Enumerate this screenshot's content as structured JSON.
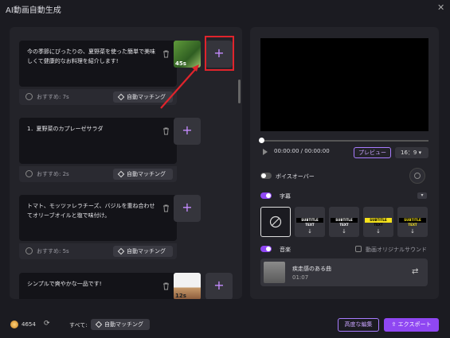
{
  "window": {
    "title": "AI動画自動生成",
    "close_glyph": "✕"
  },
  "cards": [
    {
      "text": "今の季節にぴったりの、夏野菜を使った簡単で美味しくて健康的なお料理を紹介します!",
      "recommend": "おすすめ: 7s",
      "auto_label": "自動マッチング",
      "thumb_badge": "45s",
      "has_thumb": true
    },
    {
      "text": "1．夏野菜のカプレーゼサラダ",
      "recommend": "おすすめ: 2s",
      "auto_label": "自動マッチング",
      "has_thumb": false
    },
    {
      "text": "トマト、モッツァレラチーズ、バジルを重ね合わせてオリーブオイルと塩で味付け。",
      "recommend": "おすすめ: 5s",
      "auto_label": "自動マッチング",
      "has_thumb": false
    },
    {
      "text": "シンプルで爽やかな一品です!",
      "thumb_badge": "12s",
      "has_thumb": true
    }
  ],
  "plus_glyph": "+",
  "player": {
    "time": "00:00:00 / 00:00:00",
    "preview_label": "プレビュー",
    "ratio_label": "16：9",
    "ratio_caret": "▾"
  },
  "voiceover": {
    "label": "ボイスオーバー",
    "enabled": false
  },
  "subtitles": {
    "label": "字幕",
    "enabled": true,
    "caret": "▾",
    "styles": [
      {
        "text": "SUBTITLE TEXT",
        "color": "#ffffff",
        "bg": "#000000"
      },
      {
        "text": "SUBTITLE TEXT",
        "color": "#ffffff",
        "bg": "#000000"
      },
      {
        "text": "SUBTITLE TEXT",
        "color": "#000000",
        "bg": "#f5e21b"
      },
      {
        "text": "SUBTITLE TEXT",
        "color": "#f5e21b",
        "bg": "#000000"
      }
    ],
    "download_glyph": "↓"
  },
  "music": {
    "label": "音楽",
    "enabled": true,
    "original_sound_label": "動画オリジナルサウンド",
    "track_title": "疾走感のある曲",
    "track_time": "01:07",
    "swap_glyph": "⇄"
  },
  "footer": {
    "credits": "4654",
    "refresh_glyph": "⟳",
    "all_label": "すべて:",
    "auto_label": "自動マッチング",
    "advanced_label": "高度な編集",
    "export_label": "エクスポート",
    "export_icon": "⇪"
  },
  "colors": {
    "accent": "#8f47f2",
    "accent_light": "#c9a4ff",
    "annotation": "#e0242c"
  }
}
